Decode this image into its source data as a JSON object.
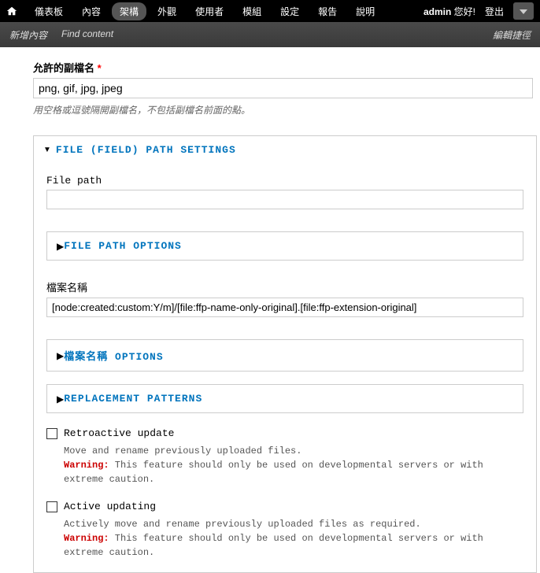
{
  "topMenu": {
    "items": [
      "儀表板",
      "內容",
      "架構",
      "外觀",
      "使用者",
      "模組",
      "設定",
      "報告",
      "說明"
    ],
    "activeIndex": 2,
    "user": "admin",
    "greeting": "您好!",
    "logout": "登出"
  },
  "subMenu": {
    "left": [
      "新增內容",
      "Find content"
    ],
    "right": "編輯捷徑"
  },
  "allowedExt": {
    "label": "允許的副檔名",
    "value": "png, gif, jpg, jpeg",
    "help": "用空格或逗號隔開副檔名，不包括副檔名前面的點。"
  },
  "mainFieldset": {
    "title": "FILE (FIELD) PATH SETTINGS",
    "filePath": {
      "label": "File path",
      "value": ""
    },
    "filePathOptions": {
      "title": "FILE PATH OPTIONS"
    },
    "fileName": {
      "label": "檔案名稱",
      "value": "[node:created:custom:Y/m]/[file:ffp-name-only-original].[file:ffp-extension-original]"
    },
    "fileNameOptions": {
      "title": "檔案名稱 OPTIONS"
    },
    "replacementPatterns": {
      "title": "REPLACEMENT PATTERNS"
    },
    "retro": {
      "label": "Retroactive update",
      "desc": "Move and rename previously uploaded files.",
      "warnLabel": "Warning:",
      "warnText": " This feature should only be used on developmental servers or with extreme caution."
    },
    "active": {
      "label": "Active updating",
      "desc": "Actively move and rename previously uploaded files as required.",
      "warnLabel": "Warning:",
      "warnText": " This feature should only be used on developmental servers or with extreme caution."
    }
  }
}
